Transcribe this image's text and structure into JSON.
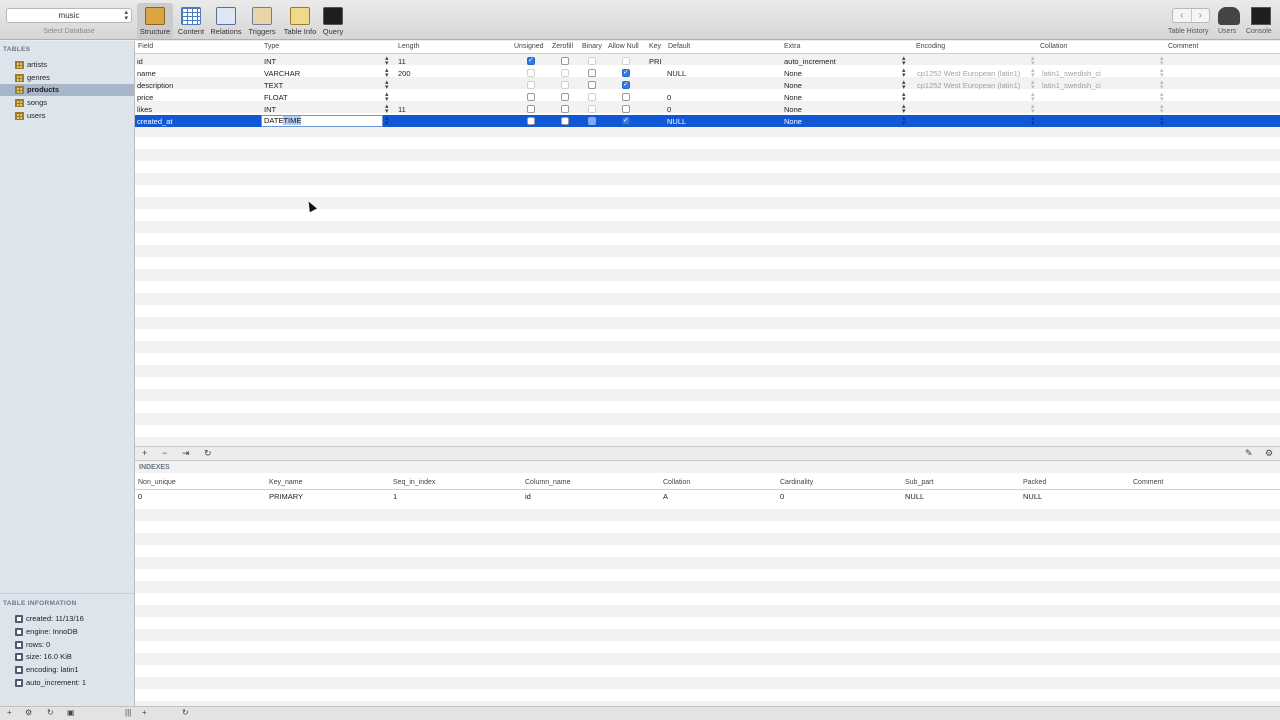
{
  "toolbar": {
    "database_value": "music",
    "database_caption": "Select Database",
    "buttons": [
      "Structure",
      "Content",
      "Relations",
      "Triggers",
      "Table Info",
      "Query"
    ],
    "right": {
      "history": "Table History",
      "users": "Users",
      "console": "Console"
    }
  },
  "sidebar": {
    "tables_heading": "TABLES",
    "tables": [
      "artists",
      "genres",
      "products",
      "songs",
      "users"
    ],
    "selected_table": "products",
    "info_heading": "TABLE INFORMATION",
    "info": [
      "created: 11/13/16",
      "engine: InnoDB",
      "rows: 0",
      "size: 16.0 KiB",
      "encoding: latin1",
      "auto_increment: 1"
    ]
  },
  "structure": {
    "headers": [
      "Field",
      "Type",
      "Length",
      "Unsigned",
      "Zerofill",
      "Binary",
      "Allow Null",
      "Key",
      "Default",
      "Extra",
      "Encoding",
      "Collation",
      "Comment"
    ],
    "rows": [
      {
        "field": "id",
        "type": "INT",
        "length": "11",
        "unsigned": "on",
        "zerofill": "off",
        "binary": "dis",
        "allow_null": "dis",
        "key": "PRI",
        "default": "",
        "extra": "auto_increment",
        "encoding": "",
        "collation": ""
      },
      {
        "field": "name",
        "type": "VARCHAR",
        "length": "200",
        "unsigned": "dis",
        "zerofill": "dis",
        "binary": "off",
        "allow_null": "on",
        "key": "",
        "default": "NULL",
        "extra": "None",
        "encoding": "cp1252 West European (latin1)",
        "collation": "latin1_swedish_ci"
      },
      {
        "field": "description",
        "type": "TEXT",
        "length": "",
        "unsigned": "dis",
        "zerofill": "dis",
        "binary": "off",
        "allow_null": "on",
        "key": "",
        "default": "",
        "extra": "None",
        "encoding": "cp1252 West European (latin1)",
        "collation": "latin1_swedish_ci"
      },
      {
        "field": "price",
        "type": "FLOAT",
        "length": "",
        "unsigned": "off",
        "zerofill": "off",
        "binary": "dis",
        "allow_null": "off",
        "key": "",
        "default": "0",
        "extra": "None",
        "encoding": "",
        "collation": ""
      },
      {
        "field": "likes",
        "type": "INT",
        "length": "11",
        "unsigned": "off",
        "zerofill": "off",
        "binary": "dis",
        "allow_null": "off",
        "key": "",
        "default": "0",
        "extra": "None",
        "encoding": "",
        "collation": ""
      },
      {
        "field": "created_at",
        "type": "DATETIME",
        "length": "",
        "unsigned": "off",
        "zerofill": "off",
        "binary": "sq",
        "allow_null": "on",
        "key": "",
        "default": "NULL",
        "extra": "None",
        "encoding": "",
        "collation": ""
      }
    ],
    "editing_type_value": "DATETIME",
    "editing_type_selected": "TIME"
  },
  "split_buttons": [
    "+",
    "−",
    "⇥",
    "↻"
  ],
  "indexes": {
    "title": "INDEXES",
    "headers": [
      "Non_unique",
      "Key_name",
      "Seq_in_index",
      "Column_name",
      "Collation",
      "Cardinality",
      "Sub_part",
      "Packed",
      "Comment"
    ],
    "rows": [
      [
        "0",
        "PRIMARY",
        "1",
        "id",
        "A",
        "0",
        "NULL",
        "NULL",
        ""
      ]
    ]
  }
}
